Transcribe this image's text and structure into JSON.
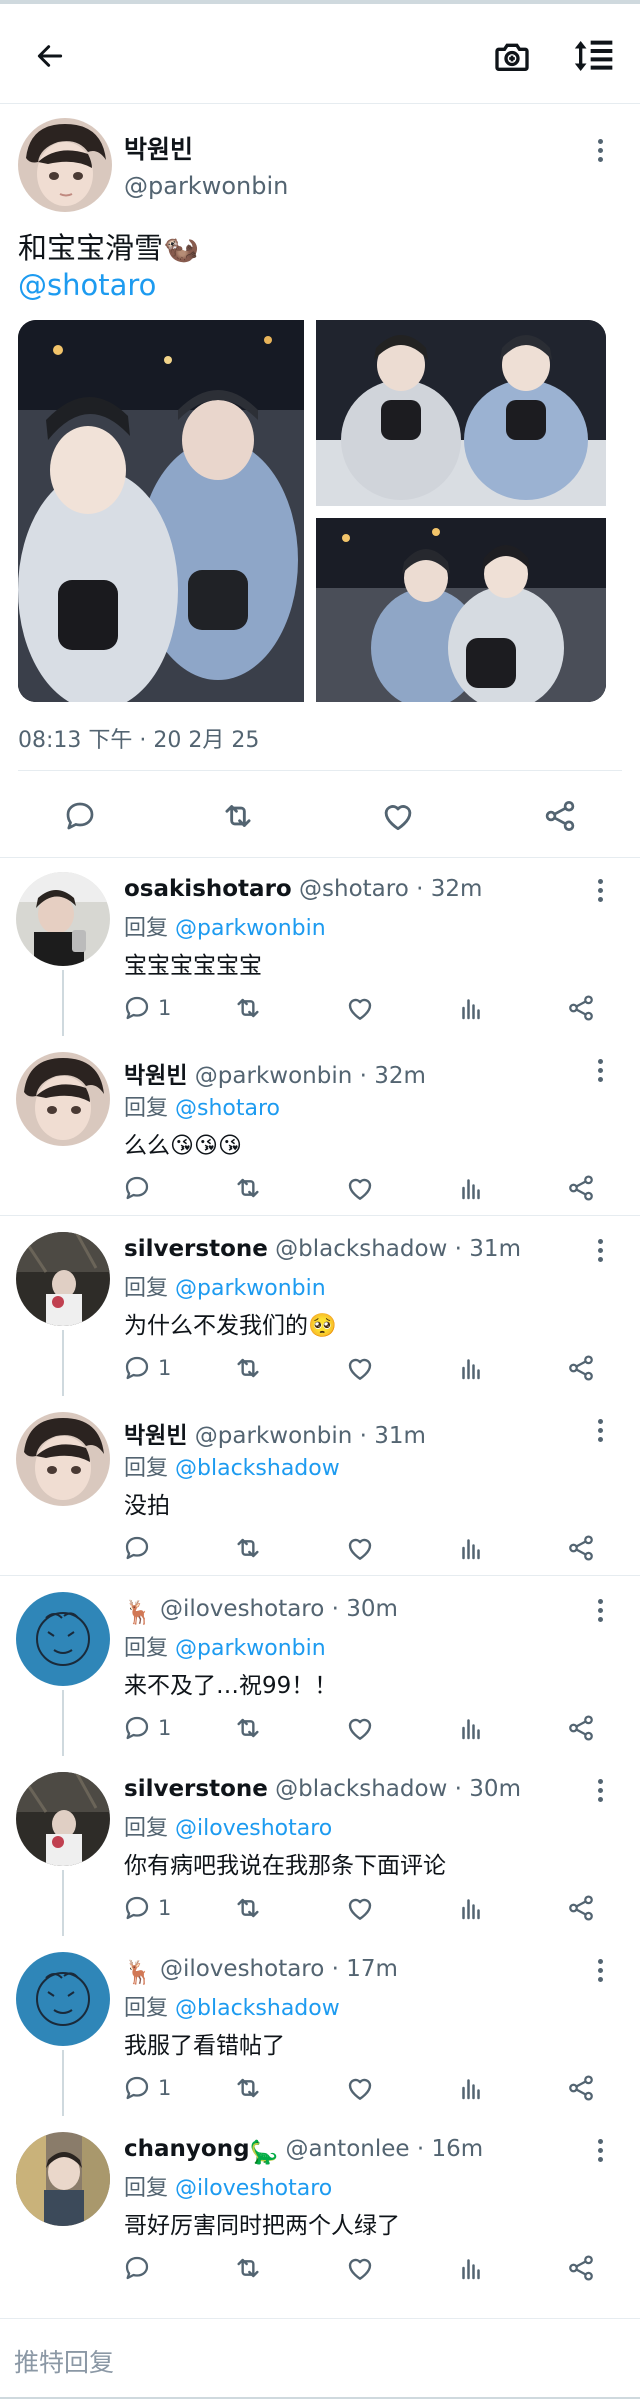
{
  "icons": {
    "back": "arrow-left-icon",
    "camera": "camera-icon",
    "sort": "sort-icon",
    "more": "more-vertical-icon",
    "reply": "reply-icon",
    "retweet": "retweet-icon",
    "like": "heart-icon",
    "views": "bar-chart-icon",
    "share": "share-icon"
  },
  "colors": {
    "accent": "#1d9bf0",
    "secondary_text": "#536471",
    "divider": "#e6ecf0"
  },
  "main_tweet": {
    "display_name": "박원빈",
    "handle": "@parkwonbin",
    "text": "和宝宝滑雪🦦",
    "mention": "@shotaro",
    "media_count": 3,
    "timestamp": "08:13 下午 · 20 2月 25"
  },
  "replies": [
    {
      "name": "osakishotaro",
      "name_emoji": "",
      "handle": "@shotaro",
      "time": "32m",
      "reply_prefix": "回复",
      "reply_to": "@parkwonbin",
      "text": "宝宝宝宝宝宝",
      "text_emoji": "",
      "reply_count": "1"
    },
    {
      "name": "박원빈",
      "name_emoji": "",
      "handle": "@parkwonbin",
      "time": "32m",
      "reply_prefix": "回复",
      "reply_to": "@shotaro",
      "text": "么么",
      "text_emoji": "😘😘😘",
      "reply_count": ""
    },
    {
      "name": "silverstone",
      "name_emoji": "",
      "handle": "@blackshadow",
      "time": "31m",
      "reply_prefix": "回复",
      "reply_to": "@parkwonbin",
      "text": "为什么不发我们的",
      "text_emoji": "🥺",
      "reply_count": "1"
    },
    {
      "name": "박원빈",
      "name_emoji": "",
      "handle": "@parkwonbin",
      "time": "31m",
      "reply_prefix": "回复",
      "reply_to": "@blackshadow",
      "text": "没拍",
      "text_emoji": "",
      "reply_count": ""
    },
    {
      "name": "",
      "name_emoji": "🦌",
      "handle": "@iloveshotaro",
      "time": "30m",
      "reply_prefix": "回复",
      "reply_to": "@parkwonbin",
      "text": "来不及了…祝99！！",
      "text_emoji": "",
      "reply_count": "1"
    },
    {
      "name": "silverstone",
      "name_emoji": "",
      "handle": "@blackshadow",
      "time": "30m",
      "reply_prefix": "回复",
      "reply_to": "@iloveshotaro",
      "text": "你有病吧我说在我那条下面评论",
      "text_emoji": "",
      "reply_count": "1"
    },
    {
      "name": "",
      "name_emoji": "🦌",
      "handle": "@iloveshotaro",
      "time": "17m",
      "reply_prefix": "回复",
      "reply_to": "@blackshadow",
      "text": "我服了看错帖了",
      "text_emoji": "",
      "reply_count": "1"
    },
    {
      "name": "chanyong",
      "name_emoji": "🦕",
      "handle": "@antonlee",
      "time": "16m",
      "reply_prefix": "回复",
      "reply_to": "@iloveshotaro",
      "text": "哥好厉害同时把两个人绿了",
      "text_emoji": "",
      "reply_count": ""
    }
  ],
  "composer": {
    "placeholder": "推特回复"
  }
}
